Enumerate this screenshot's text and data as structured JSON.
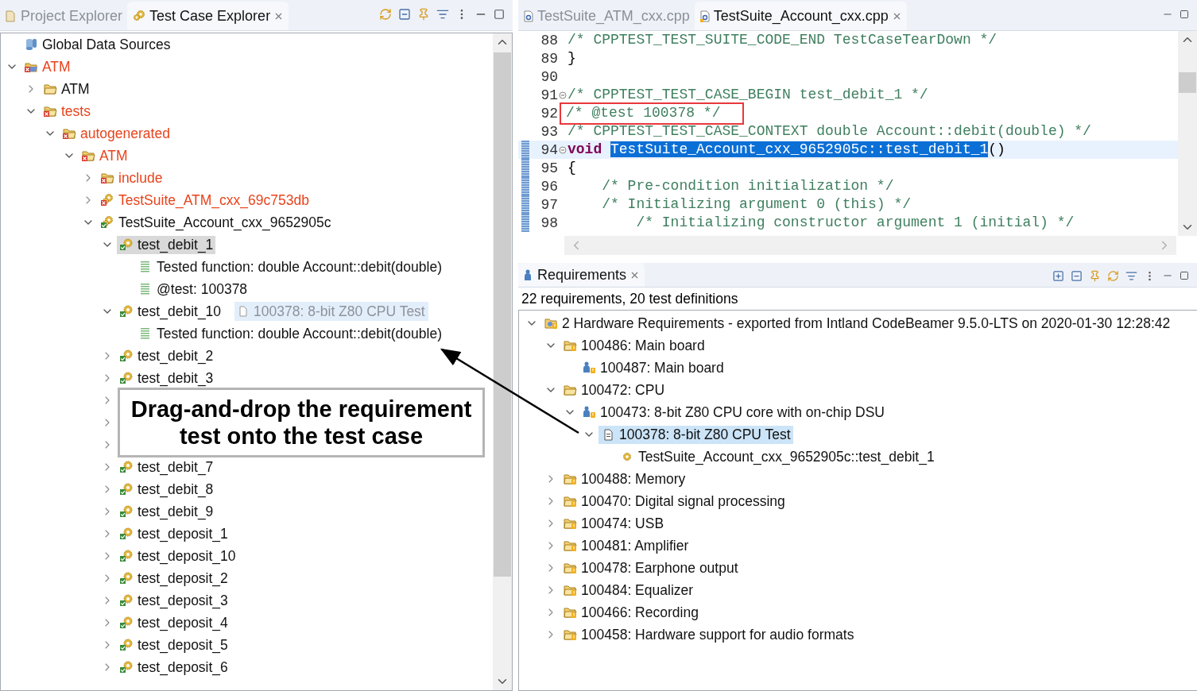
{
  "left_pane": {
    "tabs": [
      {
        "label": "Project Explorer",
        "selected": false,
        "kind": "project"
      },
      {
        "label": "Test Case Explorer",
        "selected": true,
        "kind": "tests",
        "closable": true
      }
    ],
    "tree": [
      {
        "label": "Global Data Sources",
        "kind": "datasource",
        "error": false,
        "selected": false
      },
      {
        "label": "ATM",
        "kind": "project",
        "error": true,
        "expanded": true,
        "selected": false,
        "children": [
          {
            "label": "ATM",
            "kind": "folder",
            "error": false,
            "expanded": false,
            "selected": false
          },
          {
            "label": "tests",
            "kind": "folder",
            "error": true,
            "expanded": true,
            "selected": false,
            "children": [
              {
                "label": "autogenerated",
                "kind": "folder",
                "error": true,
                "expanded": true,
                "selected": false,
                "children": [
                  {
                    "label": "ATM",
                    "kind": "folder",
                    "error": true,
                    "expanded": true,
                    "selected": false,
                    "children": [
                      {
                        "label": "include",
                        "kind": "folder",
                        "error": true,
                        "expanded": false,
                        "selected": false
                      },
                      {
                        "label": "TestSuite_ATM_cxx_69c753db",
                        "kind": "suite",
                        "error": true,
                        "expanded": false,
                        "selected": false
                      },
                      {
                        "label": "TestSuite_Account_cxx_9652905c",
                        "kind": "suite",
                        "error": false,
                        "expanded": true,
                        "selected": false,
                        "children": [
                          {
                            "label": "test_debit_1",
                            "kind": "test",
                            "error": false,
                            "expanded": true,
                            "selected": true,
                            "children": [
                              {
                                "label": "Tested function: double Account::debit(double)",
                                "kind": "info",
                                "error": false,
                                "selected": false
                              },
                              {
                                "label": "@test: 100378",
                                "kind": "info",
                                "error": false,
                                "selected": false
                              }
                            ]
                          },
                          {
                            "label": "test_debit_10",
                            "kind": "test",
                            "error": false,
                            "expanded": true,
                            "selected": false,
                            "drag_ghost": "100378: 8-bit Z80 CPU Test",
                            "children": [
                              {
                                "label": "Tested function: double Account::debit(double)",
                                "kind": "info",
                                "error": false,
                                "selected": false
                              }
                            ]
                          },
                          {
                            "label": "test_debit_2",
                            "kind": "test",
                            "error": false,
                            "expanded": false,
                            "selected": false
                          },
                          {
                            "label": "test_debit_3",
                            "kind": "test",
                            "error": false,
                            "expanded": false,
                            "selected": false
                          },
                          {
                            "expanded": false
                          },
                          {
                            "expanded": false
                          },
                          {
                            "expanded": false
                          },
                          {
                            "label": "test_debit_7",
                            "kind": "test",
                            "error": false,
                            "expanded": false,
                            "selected": false
                          },
                          {
                            "label": "test_debit_8",
                            "kind": "test",
                            "error": false,
                            "expanded": false,
                            "selected": false
                          },
                          {
                            "label": "test_debit_9",
                            "kind": "test",
                            "error": false,
                            "expanded": false,
                            "selected": false
                          },
                          {
                            "label": "test_deposit_1",
                            "kind": "test",
                            "error": false,
                            "expanded": false,
                            "selected": false
                          },
                          {
                            "label": "test_deposit_10",
                            "kind": "test",
                            "error": false,
                            "expanded": false,
                            "selected": false
                          },
                          {
                            "label": "test_deposit_2",
                            "kind": "test",
                            "error": false,
                            "expanded": false,
                            "selected": false
                          },
                          {
                            "label": "test_deposit_3",
                            "kind": "test",
                            "error": false,
                            "expanded": false,
                            "selected": false
                          },
                          {
                            "label": "test_deposit_4",
                            "kind": "test",
                            "error": false,
                            "expanded": false,
                            "selected": false
                          },
                          {
                            "label": "test_deposit_5",
                            "kind": "test",
                            "error": false,
                            "expanded": false,
                            "selected": false
                          },
                          {
                            "label": "test_deposit_6",
                            "kind": "test",
                            "error": false,
                            "expanded": false,
                            "selected": false
                          }
                        ]
                      }
                    ]
                  }
                ]
              }
            ]
          }
        ]
      }
    ]
  },
  "callout": {
    "text": "Drag-and-drop the requirement test onto the test case"
  },
  "editor": {
    "tabs": [
      {
        "label": "TestSuite_ATM_cxx.cpp",
        "selected": false,
        "closable": false
      },
      {
        "label": "TestSuite_Account_cxx.cpp",
        "selected": true,
        "closable": true
      }
    ],
    "lines": [
      {
        "number": "88",
        "segments": [
          {
            "text": "/* CPPTEST_TEST_SUITE_CODE_END TestCaseTearDown */",
            "kind": "comment"
          }
        ]
      },
      {
        "number": "89",
        "segments": [
          {
            "text": "}",
            "kind": "plain"
          }
        ]
      },
      {
        "number": "90"
      },
      {
        "number": "91",
        "fold": true,
        "segments": [
          {
            "text": "/* CPPTEST_TEST_CASE_BEGIN test_debit_1 */",
            "kind": "comment"
          }
        ]
      },
      {
        "number": "92",
        "marked": true,
        "segments": [
          {
            "text": "/* @test 100378 */",
            "kind": "comment"
          }
        ]
      },
      {
        "number": "93",
        "segments": [
          {
            "text": "/* CPPTEST_TEST_CASE_CONTEXT double Account::debit(double) */",
            "kind": "comment"
          }
        ]
      },
      {
        "number": "94",
        "fold": true,
        "current": true,
        "changed": true,
        "segments": [
          {
            "text": "void ",
            "kind": "keyword"
          },
          {
            "text": "TestSuite_Account_cxx_9652905c::test_debit_1",
            "kind": "selected"
          },
          {
            "text": "()",
            "kind": "plain"
          }
        ]
      },
      {
        "number": "95",
        "changed": true,
        "segments": [
          {
            "text": "{",
            "kind": "plain"
          }
        ]
      },
      {
        "number": "96",
        "changed": true,
        "segments": [
          {
            "text": "    /* Pre-condition initialization */",
            "kind": "comment"
          }
        ]
      },
      {
        "number": "97",
        "changed": true,
        "segments": [
          {
            "text": "    /* Initializing argument 0 (this) */",
            "kind": "comment"
          }
        ]
      },
      {
        "number": "98",
        "changed": true,
        "segments": [
          {
            "text": "        /* Initializing constructor argument 1 (initial) */",
            "kind": "comment"
          }
        ]
      }
    ]
  },
  "requirements": {
    "tab": {
      "label": "Requirements",
      "selected": true
    },
    "summary": "22 requirements, 20 test definitions",
    "tree": [
      {
        "label": "2 Hardware Requirements - exported from Intland CodeBeamer 9.5.0-LTS on 2020-01-30 12:28:42",
        "kind": "collection",
        "expanded": true,
        "selected": false,
        "children": [
          {
            "label": "100486: Main board",
            "kind": "group",
            "expanded": true,
            "selected": false,
            "children": [
              {
                "label": "100487: Main board",
                "kind": "requirement",
                "selected": false
              }
            ]
          },
          {
            "label": "100472: CPU",
            "kind": "folder",
            "expanded": true,
            "selected": false,
            "children": [
              {
                "label": "100473: 8-bit Z80 CPU core with on-chip DSU",
                "kind": "requirement",
                "expanded": true,
                "selected": false,
                "children": [
                  {
                    "label": "100378: 8-bit Z80 CPU Test",
                    "kind": "testdef",
                    "expanded": true,
                    "selected": true,
                    "children": [
                      {
                        "label": "TestSuite_Account_cxx_9652905c::test_debit_1",
                        "kind": "testcase",
                        "selected": false
                      }
                    ]
                  }
                ]
              }
            ]
          },
          {
            "label": "100488: Memory",
            "kind": "group",
            "expanded": false,
            "selected": false
          },
          {
            "label": "100470: Digital signal processing",
            "kind": "group",
            "expanded": false,
            "selected": false
          },
          {
            "label": "100474: USB",
            "kind": "group",
            "expanded": false,
            "selected": false
          },
          {
            "label": "100481: Amplifier",
            "kind": "group",
            "expanded": false,
            "selected": false
          },
          {
            "label": "100478: Earphone output",
            "kind": "group",
            "expanded": false,
            "selected": false
          },
          {
            "label": "100484: Equalizer",
            "kind": "group",
            "expanded": false,
            "selected": false
          },
          {
            "label": "100466: Recording",
            "kind": "group",
            "expanded": false,
            "selected": false
          },
          {
            "label": "100458: Hardware support for audio formats",
            "kind": "group",
            "expanded": false,
            "selected": false
          }
        ]
      }
    ]
  }
}
